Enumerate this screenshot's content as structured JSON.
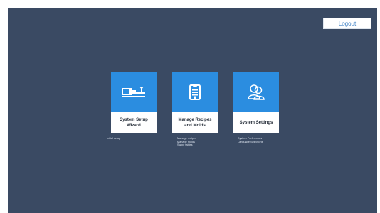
{
  "header": {
    "logout_label": "Logout"
  },
  "tiles": [
    {
      "title_line1": "System Setup",
      "title_line2": "Wizard",
      "icon": "machine-icon",
      "items": [
        "Initial setup"
      ]
    },
    {
      "title_line1": "Manage Recipes",
      "title_line2": "and Molds",
      "icon": "clipboard-icon",
      "items": [
        "Manage recipes",
        "Manage molds",
        "Swipe tables"
      ]
    },
    {
      "title_line1": "System Settings",
      "title_line2": "",
      "icon": "users-icon",
      "items": [
        "System Preferences",
        "Language Selections"
      ]
    }
  ],
  "colors": {
    "background": "#3a4a63",
    "tile_accent": "#2b8de0",
    "tile_label_bg": "#ffffff",
    "logout_text": "#3a7ec4"
  }
}
